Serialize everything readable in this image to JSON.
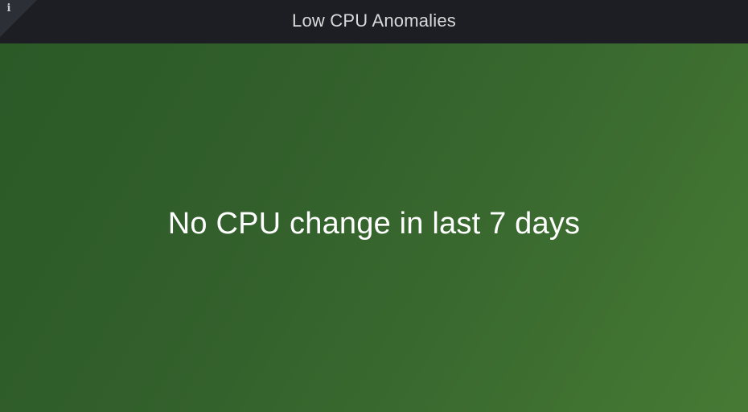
{
  "panel": {
    "title": "Low CPU Anomalies",
    "info_icon": "info-icon",
    "info_glyph": "i",
    "message": "No CPU change in last 7 days"
  },
  "colors": {
    "header_background": "#1c1e23",
    "title_text": "#d8d9da",
    "status_background": "#2b5a27",
    "status_background_end": "#467a34",
    "message_text": "#ffffff"
  }
}
